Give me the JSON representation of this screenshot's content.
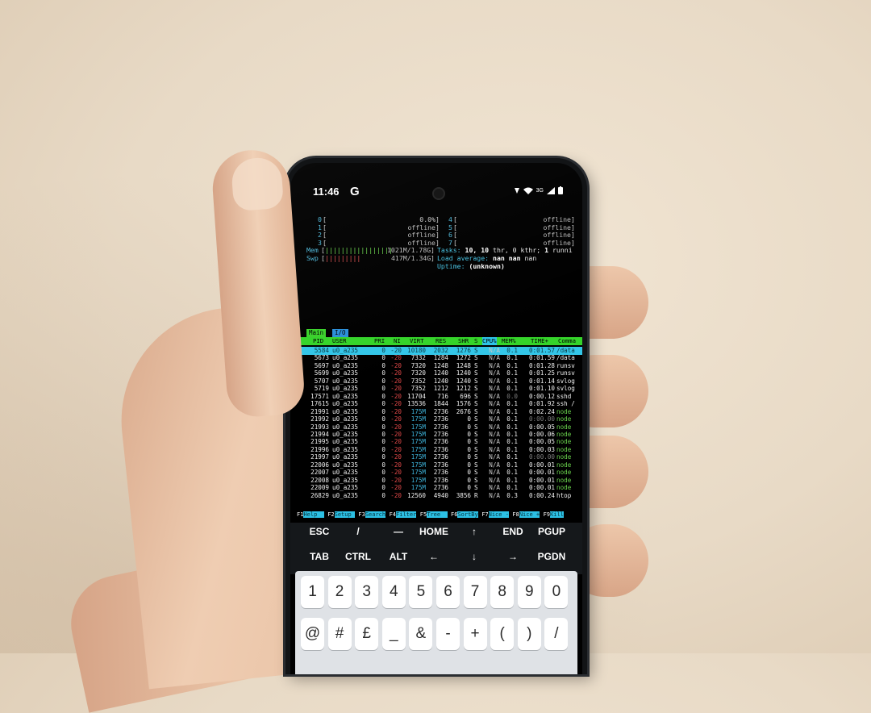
{
  "status_bar": {
    "time": "11:46",
    "app_icon": "G",
    "network": "3G"
  },
  "cpus_left": [
    {
      "label": "0",
      "value": "0.0%"
    },
    {
      "label": "1",
      "value": "offline"
    },
    {
      "label": "2",
      "value": "offline"
    },
    {
      "label": "3",
      "value": "offline"
    }
  ],
  "cpus_right": [
    {
      "label": "4",
      "value": "offline"
    },
    {
      "label": "5",
      "value": "offline"
    },
    {
      "label": "6",
      "value": "offline"
    },
    {
      "label": "7",
      "value": "offline"
    }
  ],
  "mem": {
    "label": "Mem",
    "value": "1021M/1.78G"
  },
  "swp": {
    "label": "Swp",
    "value": "417M/1.34G"
  },
  "tasks": {
    "label": "Tasks:",
    "value": "10, 10",
    "rest1": "thr, 0 kthr;",
    "running": "1",
    "rest2": "runni"
  },
  "load": {
    "label": "Load average:",
    "value": "nan nan",
    "extra": "nan"
  },
  "uptime": {
    "label": "Uptime:",
    "value": "(unknown)"
  },
  "tabs": [
    "Main",
    "I/O"
  ],
  "columns": [
    "PID",
    "USER",
    "PRI",
    "NI",
    "VIRT",
    "RES",
    "SHR",
    "S",
    "CPU%",
    "MEM%",
    "TIME+",
    "Comma"
  ],
  "processes": [
    {
      "pid": "5584",
      "user": "u0_a235",
      "pri": "0",
      "ni": "-20",
      "virt": "10180",
      "res": "2032",
      "shr": "1276",
      "s": "S",
      "cpu": "N/A",
      "mem": "0.1",
      "time": "0:01.57",
      "cmd": "/data",
      "selected": true
    },
    {
      "pid": "5673",
      "user": "u0_a235",
      "pri": "0",
      "ni": "-20",
      "virt": "7332",
      "res": "1284",
      "shr": "1272",
      "s": "S",
      "cpu": "N/A",
      "mem": "0.1",
      "time": "0:01.59",
      "cmd": "/data"
    },
    {
      "pid": "5697",
      "user": "u0_a235",
      "pri": "0",
      "ni": "-20",
      "virt": "7320",
      "res": "1248",
      "shr": "1248",
      "s": "S",
      "cpu": "N/A",
      "mem": "0.1",
      "time": "0:01.28",
      "cmd": "runsv"
    },
    {
      "pid": "5699",
      "user": "u0_a235",
      "pri": "0",
      "ni": "-20",
      "virt": "7320",
      "res": "1240",
      "shr": "1240",
      "s": "S",
      "cpu": "N/A",
      "mem": "0.1",
      "time": "0:01.25",
      "cmd": "runsv"
    },
    {
      "pid": "5707",
      "user": "u0_a235",
      "pri": "0",
      "ni": "-20",
      "virt": "7352",
      "res": "1240",
      "shr": "1240",
      "s": "S",
      "cpu": "N/A",
      "mem": "0.1",
      "time": "0:01.14",
      "cmd": "svlog"
    },
    {
      "pid": "5719",
      "user": "u0_a235",
      "pri": "0",
      "ni": "-20",
      "virt": "7352",
      "res": "1212",
      "shr": "1212",
      "s": "S",
      "cpu": "N/A",
      "mem": "0.1",
      "time": "0:01.10",
      "cmd": "svlog"
    },
    {
      "pid": "17571",
      "user": "u0_a235",
      "pri": "0",
      "ni": "-20",
      "virt": "11704",
      "res": "716",
      "shr": "696",
      "s": "S",
      "cpu": "N/A",
      "mem": "0.0",
      "time": "0:00.12",
      "cmd": "sshd"
    },
    {
      "pid": "17615",
      "user": "u0_a235",
      "pri": "0",
      "ni": "-20",
      "virt": "13536",
      "res": "1844",
      "shr": "1576",
      "s": "S",
      "cpu": "N/A",
      "mem": "0.1",
      "time": "0:01.92",
      "cmd": "ssh /"
    },
    {
      "pid": "21991",
      "user": "u0_a235",
      "pri": "0",
      "ni": "-20",
      "virt": "175M",
      "res": "2736",
      "shr": "2676",
      "s": "S",
      "cpu": "N/A",
      "mem": "0.1",
      "time": "0:02.24",
      "cmd": "node"
    },
    {
      "pid": "21992",
      "user": "u0_a235",
      "pri": "0",
      "ni": "-20",
      "virt": "175M",
      "res": "2736",
      "shr": "0",
      "s": "S",
      "cpu": "N/A",
      "mem": "0.1",
      "time": "0:00.00",
      "cmd": "node"
    },
    {
      "pid": "21993",
      "user": "u0_a235",
      "pri": "0",
      "ni": "-20",
      "virt": "175M",
      "res": "2736",
      "shr": "0",
      "s": "S",
      "cpu": "N/A",
      "mem": "0.1",
      "time": "0:00.05",
      "cmd": "node"
    },
    {
      "pid": "21994",
      "user": "u0_a235",
      "pri": "0",
      "ni": "-20",
      "virt": "175M",
      "res": "2736",
      "shr": "0",
      "s": "S",
      "cpu": "N/A",
      "mem": "0.1",
      "time": "0:00.06",
      "cmd": "node"
    },
    {
      "pid": "21995",
      "user": "u0_a235",
      "pri": "0",
      "ni": "-20",
      "virt": "175M",
      "res": "2736",
      "shr": "0",
      "s": "S",
      "cpu": "N/A",
      "mem": "0.1",
      "time": "0:00.05",
      "cmd": "node"
    },
    {
      "pid": "21996",
      "user": "u0_a235",
      "pri": "0",
      "ni": "-20",
      "virt": "175M",
      "res": "2736",
      "shr": "0",
      "s": "S",
      "cpu": "N/A",
      "mem": "0.1",
      "time": "0:00.03",
      "cmd": "node"
    },
    {
      "pid": "21997",
      "user": "u0_a235",
      "pri": "0",
      "ni": "-20",
      "virt": "175M",
      "res": "2736",
      "shr": "0",
      "s": "S",
      "cpu": "N/A",
      "mem": "0.1",
      "time": "0:00.00",
      "cmd": "node"
    },
    {
      "pid": "22006",
      "user": "u0_a235",
      "pri": "0",
      "ni": "-20",
      "virt": "175M",
      "res": "2736",
      "shr": "0",
      "s": "S",
      "cpu": "N/A",
      "mem": "0.1",
      "time": "0:00.01",
      "cmd": "node"
    },
    {
      "pid": "22007",
      "user": "u0_a235",
      "pri": "0",
      "ni": "-20",
      "virt": "175M",
      "res": "2736",
      "shr": "0",
      "s": "S",
      "cpu": "N/A",
      "mem": "0.1",
      "time": "0:00.01",
      "cmd": "node"
    },
    {
      "pid": "22008",
      "user": "u0_a235",
      "pri": "0",
      "ni": "-20",
      "virt": "175M",
      "res": "2736",
      "shr": "0",
      "s": "S",
      "cpu": "N/A",
      "mem": "0.1",
      "time": "0:00.01",
      "cmd": "node"
    },
    {
      "pid": "22009",
      "user": "u0_a235",
      "pri": "0",
      "ni": "-20",
      "virt": "175M",
      "res": "2736",
      "shr": "0",
      "s": "S",
      "cpu": "N/A",
      "mem": "0.1",
      "time": "0:00.01",
      "cmd": "node"
    },
    {
      "pid": "26829",
      "user": "u0_a235",
      "pri": "0",
      "ni": "-20",
      "virt": "12560",
      "res": "4940",
      "shr": "3856",
      "s": "R",
      "cpu": "N/A",
      "mem": "0.3",
      "time": "0:00.24",
      "cmd": "htop"
    }
  ],
  "fkeys": [
    {
      "n": "F1",
      "l": "Help  "
    },
    {
      "n": "F2",
      "l": "Setup "
    },
    {
      "n": "F3",
      "l": "Search"
    },
    {
      "n": "F4",
      "l": "Filter"
    },
    {
      "n": "F5",
      "l": "Tree  "
    },
    {
      "n": "F6",
      "l": "SortBy"
    },
    {
      "n": "F7",
      "l": "Nice -"
    },
    {
      "n": "F8",
      "l": "Nice +"
    },
    {
      "n": "F9",
      "l": "Kill"
    }
  ],
  "extra_keys_row1": [
    "ESC",
    "/",
    "—",
    "HOME",
    "↑",
    "END",
    "PGUP"
  ],
  "extra_keys_row2": [
    "TAB",
    "CTRL",
    "ALT",
    "←",
    "↓",
    "→",
    "PGDN"
  ],
  "keyboard_row1": [
    "1",
    "2",
    "3",
    "4",
    "5",
    "6",
    "7",
    "8",
    "9",
    "0"
  ],
  "keyboard_row2": [
    "@",
    "#",
    "£",
    "_",
    "&",
    "-",
    "+",
    "(",
    ")",
    "/"
  ],
  "colors": {
    "header": "#35d42a",
    "selection": "#33c6e8",
    "nice": "#e04848",
    "mem_bar": "#6edb4f",
    "swp_bar": "#e25252"
  }
}
